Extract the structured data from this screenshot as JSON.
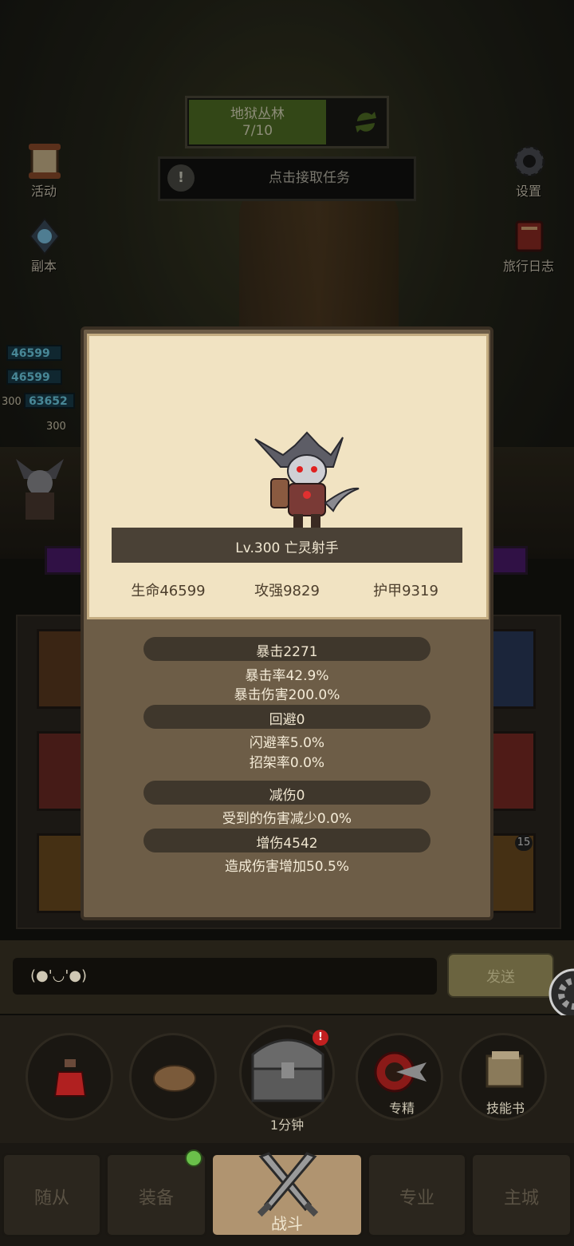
{
  "top": {
    "map_name": "地狱丛林",
    "map_progress": "7/10",
    "task_text": "点击接取任务"
  },
  "side": {
    "left": [
      {
        "label": "活动"
      },
      {
        "label": "副本"
      }
    ],
    "right": [
      {
        "label": "设置"
      },
      {
        "label": "旅行日志"
      }
    ]
  },
  "battle": {
    "hp_values": [
      "46599",
      "46599",
      "63652"
    ],
    "levels": [
      "300",
      "300"
    ]
  },
  "modal": {
    "name": "Lv.300 亡灵射手",
    "stats": {
      "hp": "生命46599",
      "atk": "攻强9829",
      "armor": "护甲9319"
    },
    "sections": [
      {
        "title": "暴击2271",
        "lines": [
          "暴击率42.9%",
          "暴击伤害200.0%"
        ]
      },
      {
        "title": "回避0",
        "lines": [
          "闪避率5.0%",
          "招架率0.0%"
        ]
      },
      {
        "title": "减伤0",
        "lines": [
          "受到的伤害减少0.0%"
        ]
      },
      {
        "title": "增伤4542",
        "lines": [
          "造成伤害增加50.5%"
        ]
      }
    ]
  },
  "tile_badge": "15",
  "chat": {
    "text": "(●'◡'●)",
    "send_label": "发送"
  },
  "actions": {
    "chest_timer": "1分钟",
    "mastery": "专精",
    "skill_book": "技能书",
    "alert": "!"
  },
  "nav": {
    "tabs": [
      {
        "label": "随从"
      },
      {
        "label": "装备"
      },
      {
        "label": "战斗"
      },
      {
        "label": "专业"
      },
      {
        "label": "主城"
      }
    ]
  },
  "colors": {
    "modal_card": "#f1e3c2",
    "modal_frame": "#6d5d47",
    "pill": "#3f372c",
    "map_fill": "#4f6e24"
  }
}
